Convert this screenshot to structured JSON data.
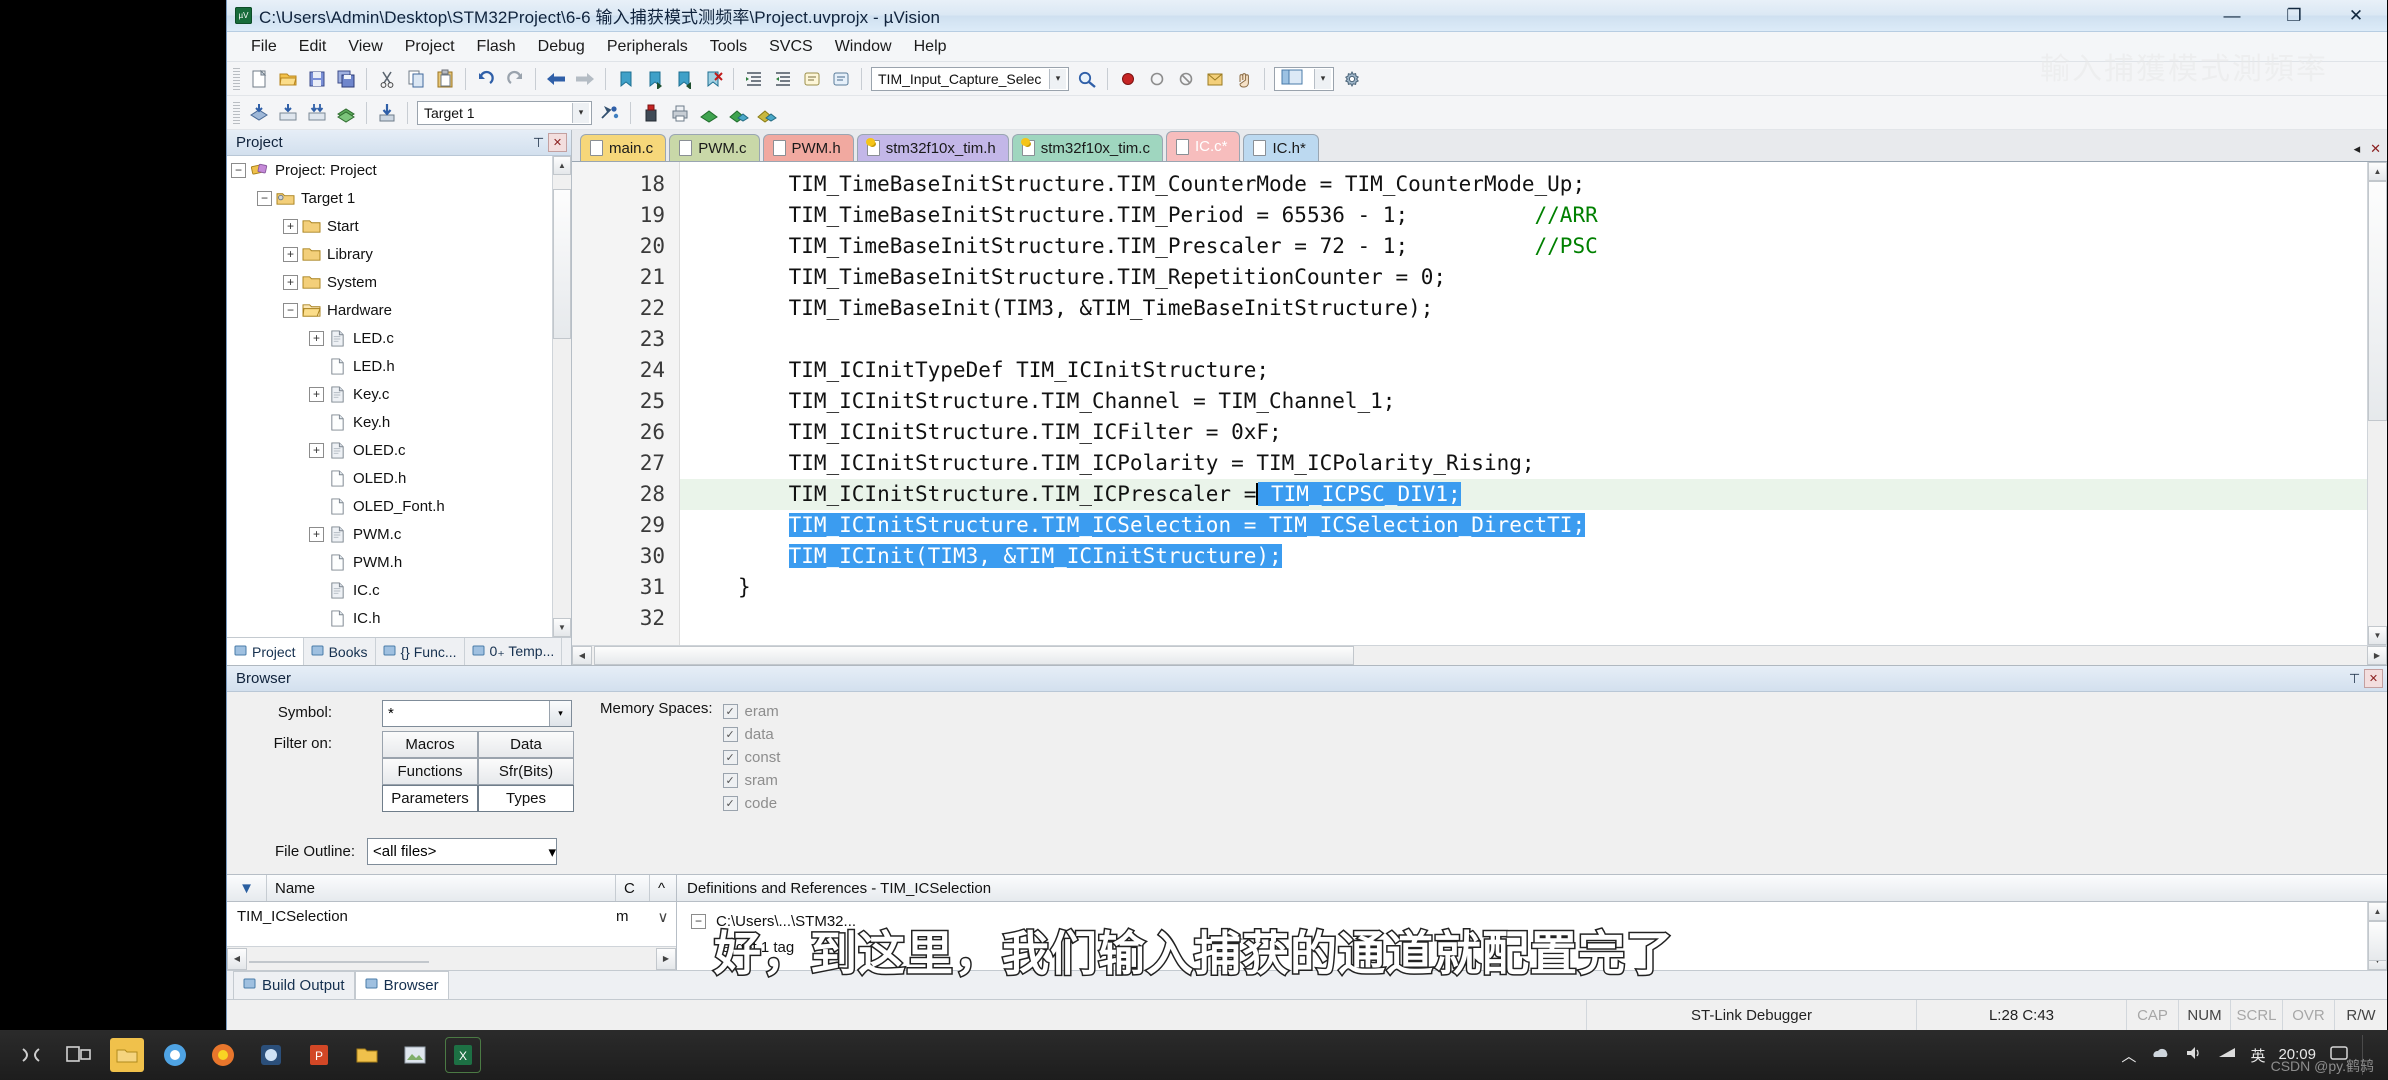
{
  "window": {
    "title": "C:\\Users\\Admin\\Desktop\\STM32Project\\6-6 输入捕获模式测频率\\Project.uvprojx - µVision",
    "minimize": "—",
    "maximize": "❐",
    "close": "✕"
  },
  "menu": {
    "items": [
      "File",
      "Edit",
      "View",
      "Project",
      "Flash",
      "Debug",
      "Peripherals",
      "Tools",
      "SVCS",
      "Window",
      "Help"
    ]
  },
  "toolbar1": {
    "search_value": "TIM_Input_Capture_Selec",
    "icons": [
      "new-file-icon",
      "open-folder-icon",
      "save-icon",
      "save-all-icon",
      "cut-icon",
      "copy-icon",
      "paste-icon",
      "undo-icon",
      "redo-icon",
      "back-icon",
      "forward-icon",
      "bookmark-icon",
      "bookmark-next-icon",
      "bookmark-prev-icon",
      "bookmark-clear-icon",
      "indent-icon",
      "outdent-icon",
      "comment-icon",
      "uncomment-icon",
      "find-in-files-icon",
      "debug-stop-icon",
      "breakpoint-icon",
      "breakpoint-disable-icon",
      "breakpoint-kill-icon",
      "insert-icon",
      "window-layout-icon",
      "configure-icon"
    ]
  },
  "toolbar2": {
    "target_value": "Target 1",
    "icons": [
      "build-icon",
      "rebuild-icon",
      "batch-build-icon",
      "translate-icon",
      "target-options-icon",
      "manage-project-icon",
      "books-icon",
      "packs-icon",
      "pack-installer-icon"
    ]
  },
  "project_pane": {
    "title": "Project",
    "pin_icon": "pin-icon",
    "close_icon": "close-icon",
    "tree": [
      {
        "label": "Project: Project",
        "depth": 0,
        "expander": "-",
        "icon": "project-icon"
      },
      {
        "label": "Target 1",
        "depth": 1,
        "expander": "-",
        "icon": "target-icon"
      },
      {
        "label": "Start",
        "depth": 2,
        "expander": "+",
        "icon": "folder-icon"
      },
      {
        "label": "Library",
        "depth": 2,
        "expander": "+",
        "icon": "folder-icon"
      },
      {
        "label": "System",
        "depth": 2,
        "expander": "+",
        "icon": "folder-icon"
      },
      {
        "label": "Hardware",
        "depth": 2,
        "expander": "-",
        "icon": "folder-open-icon"
      },
      {
        "label": "LED.c",
        "depth": 3,
        "expander": "+",
        "icon": "c-file-icon"
      },
      {
        "label": "LED.h",
        "depth": 3,
        "expander": "",
        "icon": "h-file-icon"
      },
      {
        "label": "Key.c",
        "depth": 3,
        "expander": "+",
        "icon": "c-file-icon"
      },
      {
        "label": "Key.h",
        "depth": 3,
        "expander": "",
        "icon": "h-file-icon"
      },
      {
        "label": "OLED.c",
        "depth": 3,
        "expander": "+",
        "icon": "c-file-icon"
      },
      {
        "label": "OLED.h",
        "depth": 3,
        "expander": "",
        "icon": "h-file-icon"
      },
      {
        "label": "OLED_Font.h",
        "depth": 3,
        "expander": "",
        "icon": "h-file-icon"
      },
      {
        "label": "PWM.c",
        "depth": 3,
        "expander": "+",
        "icon": "c-file-icon"
      },
      {
        "label": "PWM.h",
        "depth": 3,
        "expander": "",
        "icon": "h-file-icon"
      },
      {
        "label": "IC.c",
        "depth": 3,
        "expander": "",
        "icon": "c-file-icon"
      },
      {
        "label": "IC.h",
        "depth": 3,
        "expander": "",
        "icon": "h-file-icon"
      }
    ],
    "tabs": [
      {
        "label": "Project",
        "icon": "project-tab-icon",
        "active": true
      },
      {
        "label": "Books",
        "icon": "books-tab-icon",
        "active": false
      },
      {
        "label": "{} Func...",
        "icon": "functions-tab-icon",
        "active": false
      },
      {
        "label": "0₊ Temp...",
        "icon": "templates-tab-icon",
        "active": false
      }
    ]
  },
  "editor": {
    "tabs": [
      {
        "label": "main.c",
        "color": "#f6d77a",
        "active": false,
        "icon": "file-icon"
      },
      {
        "label": "PWM.c",
        "color": "#c9d8a8",
        "active": false,
        "icon": "file-icon"
      },
      {
        "label": "PWM.h",
        "color": "#f1a9a0",
        "active": false,
        "icon": "file-icon"
      },
      {
        "label": "stm32f10x_tim.h",
        "color": "#c3b7e8",
        "active": false,
        "icon": "file-key-icon"
      },
      {
        "label": "stm32f10x_tim.c",
        "color": "#9fd6bf",
        "active": false,
        "icon": "file-key-icon"
      },
      {
        "label": "IC.c*",
        "color": "#f7bdbd",
        "active": true,
        "icon": "file-icon"
      },
      {
        "label": "IC.h*",
        "color": "#bcd9f0",
        "active": false,
        "icon": "file-icon"
      }
    ],
    "tab_scroll_left": "◂",
    "tab_scroll_right": "▸",
    "tab_close": "✕",
    "lines": [
      {
        "n": 18,
        "text": "    TIM_TimeBaseInitStructure.TIM_CounterMode = TIM_CounterMode_Up;"
      },
      {
        "n": 19,
        "text": "    TIM_TimeBaseInitStructure.TIM_Period = 65536 - 1;          //ARR"
      },
      {
        "n": 20,
        "text": "    TIM_TimeBaseInitStructure.TIM_Prescaler = 72 - 1;          //PSC"
      },
      {
        "n": 21,
        "text": "    TIM_TimeBaseInitStructure.TIM_RepetitionCounter = 0;"
      },
      {
        "n": 22,
        "text": "    TIM_TimeBaseInit(TIM3, &TIM_TimeBaseInitStructure);"
      },
      {
        "n": 23,
        "text": ""
      },
      {
        "n": 24,
        "text": "    TIM_ICInitTypeDef TIM_ICInitStructure;"
      },
      {
        "n": 25,
        "text": "    TIM_ICInitStructure.TIM_Channel = TIM_Channel_1;"
      },
      {
        "n": 26,
        "text": "    TIM_ICInitStructure.TIM_ICFilter = 0xF;"
      },
      {
        "n": 27,
        "text": "    TIM_ICInitStructure.TIM_ICPolarity = TIM_ICPolarity_Rising;"
      },
      {
        "n": 28,
        "text": "    TIM_ICInitStructure.TIM_ICPrescaler = TIM_ICPSC_DIV1;"
      },
      {
        "n": 29,
        "text": "    TIM_ICInitStructure.TIM_ICSelection = TIM_ICSelection_DirectTI;"
      },
      {
        "n": 30,
        "text": "    TIM_ICInit(TIM3, &TIM_ICInitStructure);"
      },
      {
        "n": 31,
        "text": "}"
      },
      {
        "n": 32,
        "text": ""
      }
    ]
  },
  "browser": {
    "title": "Browser",
    "pin_icon": "pin-icon",
    "close_icon": "close-icon",
    "symbol_label": "Symbol:",
    "symbol_value": "*",
    "filter_label": "Filter on:",
    "filter_buttons": [
      "Macros",
      "Data",
      "Functions",
      "Sfr(Bits)",
      "Parameters",
      "Types"
    ],
    "memory_label": "Memory Spaces:",
    "memory_spaces": [
      "eram",
      "data",
      "const",
      "sram",
      "code"
    ],
    "file_outline_label": "File Outline:",
    "file_outline_value": "<all files>",
    "list_headers": [
      "Name",
      "C",
      "^"
    ],
    "list_rows": [
      {
        "name": "TIM_ICSelection",
        "c": "m"
      }
    ],
    "definitions_title": "Definitions and References - TIM_ICSelection",
    "definition_rows": [
      "C:\\Users\\...\\STM32...",
      "Target 1  tag"
    ]
  },
  "bottom_tabs": [
    {
      "label": "Build Output",
      "icon": "build-output-icon",
      "active": false
    },
    {
      "label": "Browser",
      "icon": "browser-icon",
      "active": true
    }
  ],
  "status_bar": {
    "debugger": "ST-Link Debugger",
    "position": "L:28 C:43",
    "indicators": [
      "CAP",
      "NUM",
      "SCRL",
      "OVR",
      "R/W"
    ]
  },
  "taskbar": {
    "icons": [
      "cortana-icon",
      "task-view-icon",
      "explorer-icon",
      "chrome-icon",
      "firefox-icon",
      "vlc-icon",
      "powerpoint-icon",
      "folder-icon",
      "photos-icon",
      "excel-icon"
    ],
    "tray": [
      "chevron-up-icon",
      "onedrive-icon",
      "volume-icon",
      "network-icon"
    ],
    "ime": "英",
    "time": "20:09",
    "show_desktop": ""
  },
  "overlay": {
    "subtitle": "好，到这里，我们输入捕获的通道就配置完了",
    "ghost": "輸入捕獲模式測頻率",
    "watermark": "CSDN @py.鹤鸫"
  }
}
